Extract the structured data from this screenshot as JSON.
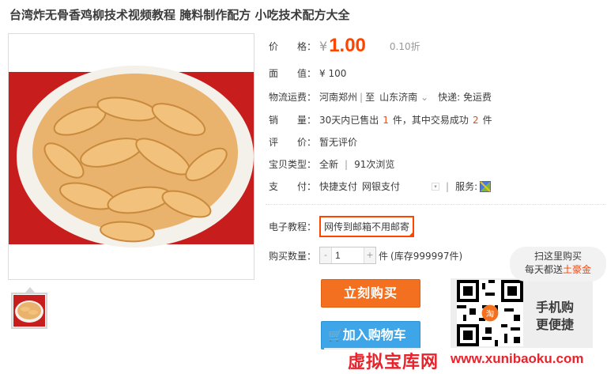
{
  "title": "台湾炸无骨香鸡柳技术视频教程 腌料制作配方 小吃技术配方大全",
  "price": {
    "label": "价　　格：",
    "currency": "¥",
    "value": "1.00",
    "discount": "0.10折"
  },
  "face_value": {
    "label": "面　　值：",
    "value": "¥ 100"
  },
  "shipping": {
    "label": "物流运费：",
    "from": "河南郑州",
    "to_word": "至",
    "to": "山东济南",
    "arrow": "⌄",
    "express": "快递: 免运费"
  },
  "sales": {
    "label": "销　　量：",
    "prefix": "30天内已售出",
    "count": "1",
    "mid": "件，其中交易成功",
    "success": "2",
    "suffix": "件"
  },
  "review": {
    "label": "评　　价：",
    "value": "暂无评价"
  },
  "item_type": {
    "label": "宝贝类型：",
    "condition": "全新",
    "sep": "|",
    "views": "91次浏览"
  },
  "payment": {
    "label": "支　　付：",
    "methods": [
      "快捷支付",
      "网银支付"
    ],
    "service_label": "服务:"
  },
  "sku": {
    "label": "电子教程：",
    "selected": "网传到邮箱不用邮寄"
  },
  "quantity": {
    "label": "购买数量：",
    "value": "1",
    "unit": "件",
    "stock": "(库存999997件)",
    "minus": "-",
    "plus": "+"
  },
  "buttons": {
    "buy_now": "立刻购买",
    "add_cart": "加入购物车"
  },
  "mobile": {
    "line1": "手机购",
    "line2": "更便捷",
    "bubble_line1": "扫这里购买",
    "bubble_line2_prefix": "每天都送",
    "bubble_line2_highlight": "土豪金"
  },
  "watermark": {
    "cn": "虚拟宝库网",
    "en": "www.xunibaoku.com"
  },
  "colors": {
    "accent": "#ff4400",
    "buy": "#f37021",
    "cart": "#3ea5e8",
    "watermark": "#e8232c"
  }
}
